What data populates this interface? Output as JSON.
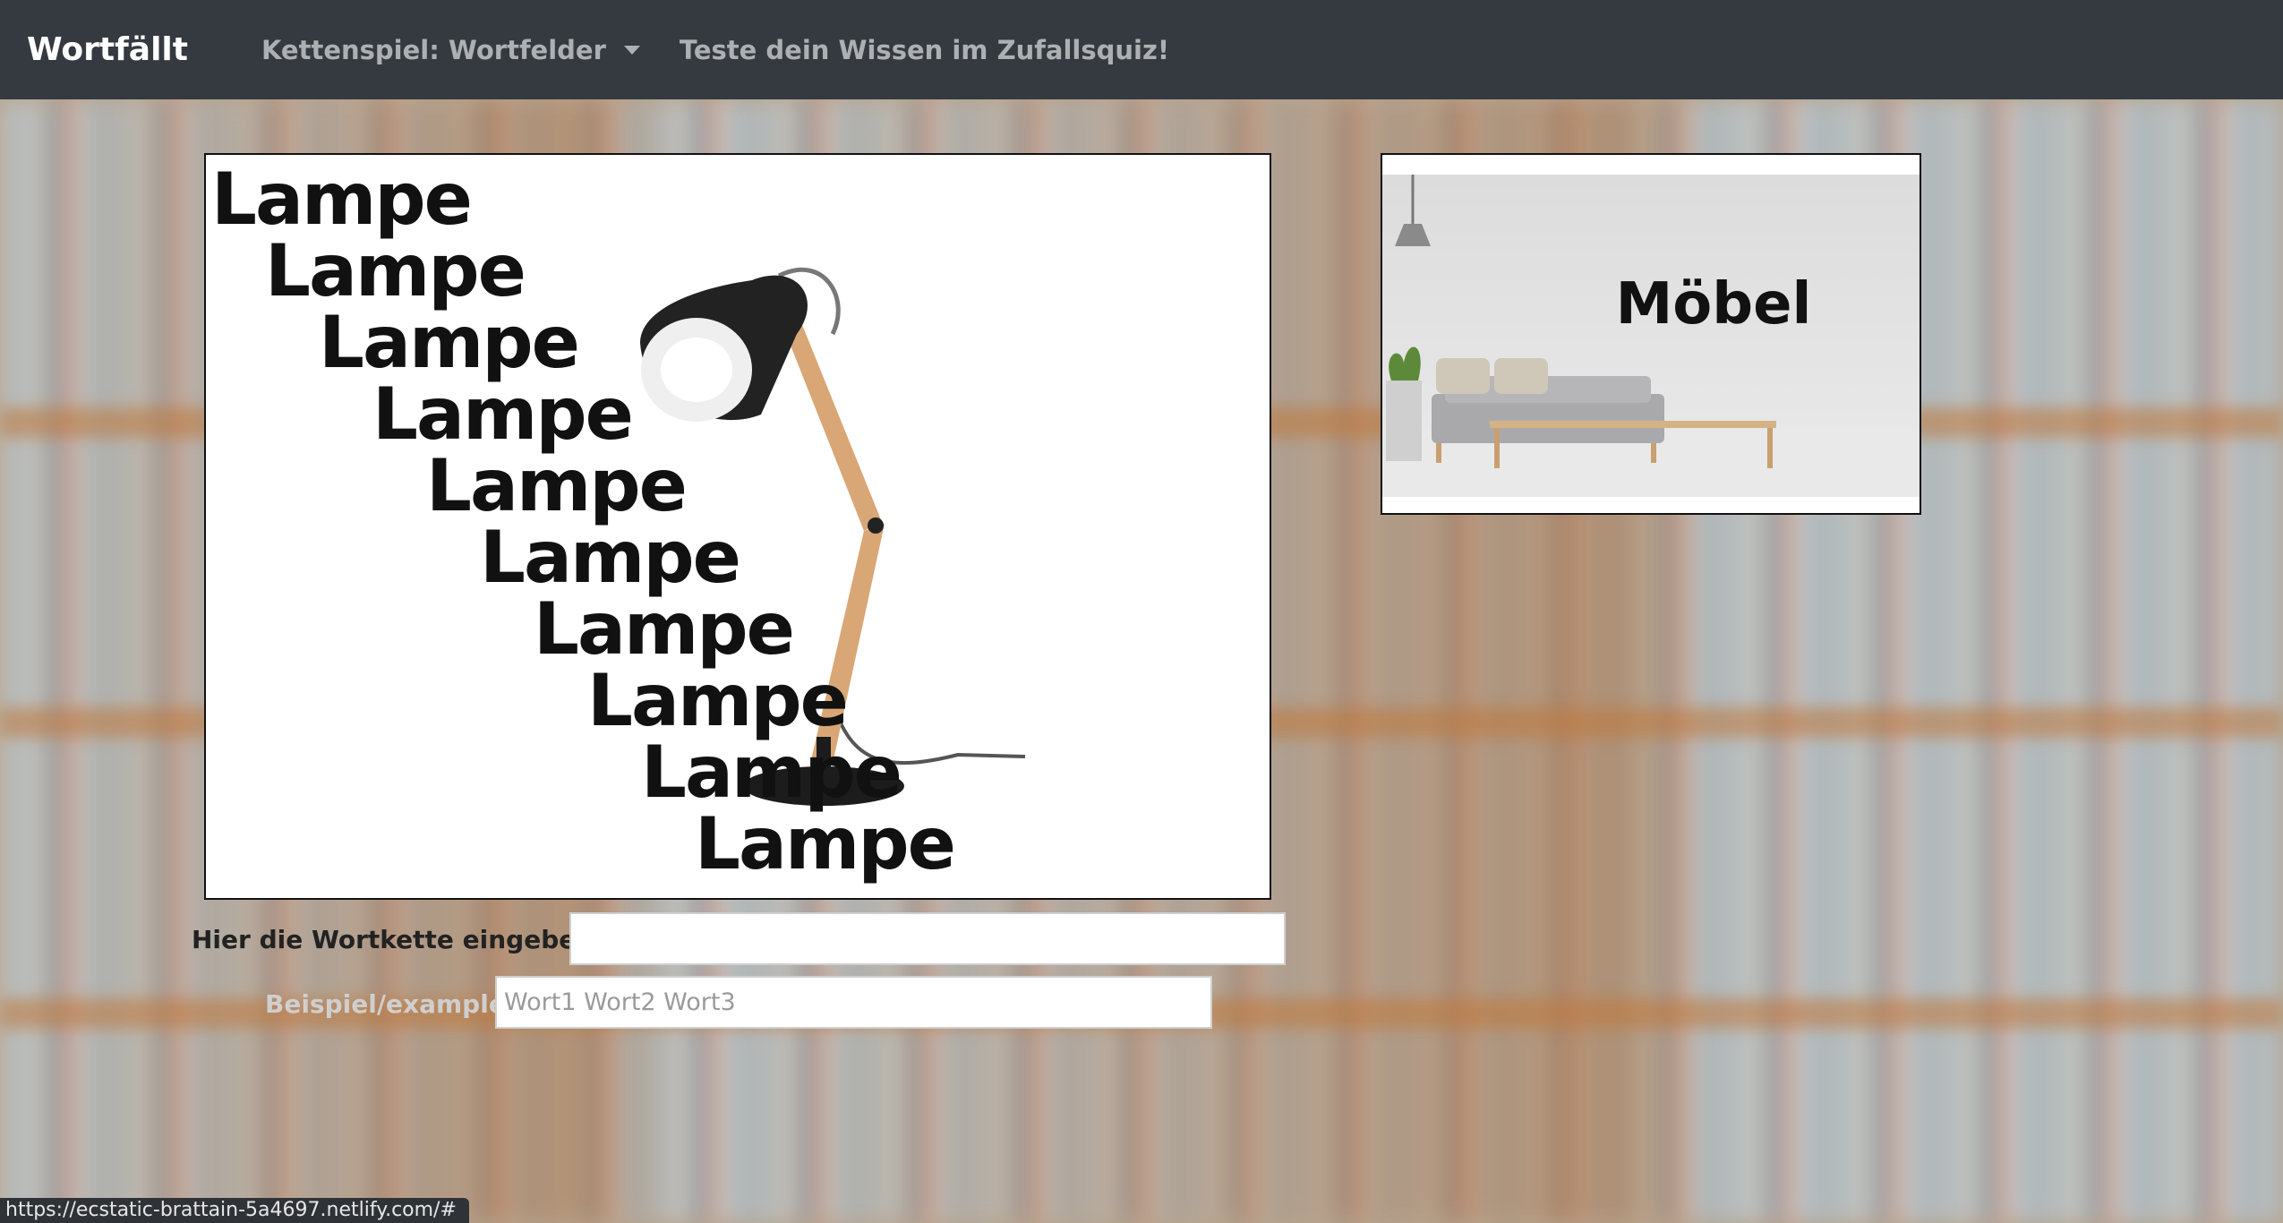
{
  "navbar": {
    "brand": "Wortfällt",
    "dropdown_label": "Kettenspiel: Wortfelder",
    "quiz_link": "Teste dein Wissen im Zufallsquiz!"
  },
  "main_image": {
    "words": [
      "Lampe",
      "Lampe",
      "Lampe",
      "Lampe",
      "Lampe",
      "Lampe",
      "Lampe",
      "Lampe",
      "Lampe",
      "Lampe"
    ]
  },
  "side_image": {
    "label": "Möbel"
  },
  "form": {
    "chain_label": "Hier die Wortkette eingeben:",
    "chain_value": "",
    "example_label": "Beispiel/example:",
    "example_value": "Wort1 Wort2 Wort3"
  },
  "status_url": "https://ecstatic-brattain-5a4697.netlify.com/#"
}
